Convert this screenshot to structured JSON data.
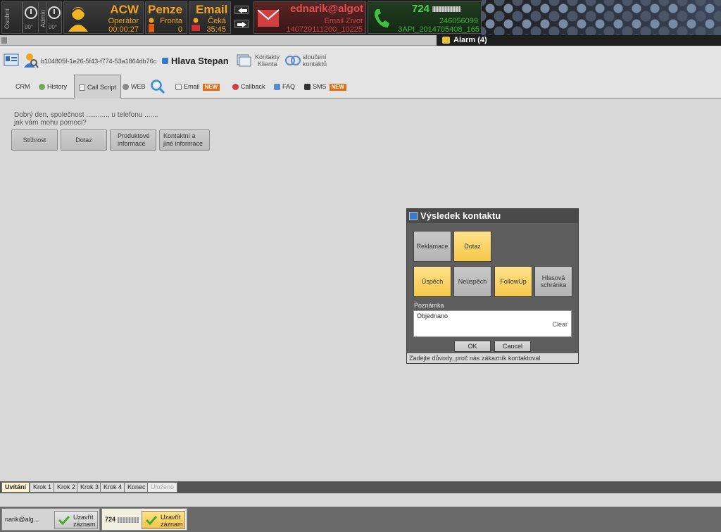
{
  "topbar": {
    "status_labels": [
      "Osobní",
      "Admin"
    ],
    "timers": [
      "00°",
      "00°"
    ],
    "acw": {
      "title": "ACW",
      "role": "Operátor",
      "time": "00:00:27"
    },
    "penze": {
      "title": "Penze",
      "label": "Fronta",
      "count": "0"
    },
    "email": {
      "title": "Email",
      "label": "Čeká",
      "time": "35:45"
    },
    "email_session": {
      "address": "ednarik@algot",
      "subject": "Email Zivot",
      "id": "140729111200_10225"
    },
    "phone_session": {
      "number": "724",
      "number2": "246056099",
      "id": "3API_2014705408_165"
    },
    "alarm": "Alarm (4)"
  },
  "header": {
    "contact_id": "b104805f-1e26-5f43-f774-53a1864db76c",
    "name": "Hlava Stepan",
    "link_contacts": [
      "Kontakty",
      "Klienta"
    ],
    "link_merge": [
      "sloučení",
      "kontaktů"
    ]
  },
  "tabs": {
    "crm": "CRM",
    "history": "History",
    "callscript": "Call Script",
    "web": "WEB",
    "email": "Email",
    "callback": "Callback",
    "faq": "FAQ",
    "sms": "SMS",
    "new_badge": "NEW"
  },
  "script": {
    "greeting_line1": "Dobrý den, společnost ..........., u telefonu .......",
    "greeting_line2": "jak vám mohu pomoci?",
    "buttons": [
      "Stížnost",
      "Dotaz",
      "Produktové informace",
      "Kontaktní a jiné informace"
    ]
  },
  "dialog": {
    "title": "Výsledek kontaktu",
    "row1": [
      "Reklamace",
      "Dotaz"
    ],
    "row2": [
      "Úspěch",
      "Neúspěch",
      "FollowUp",
      "Hlasová schránka"
    ],
    "note_label": "Poznámka",
    "note_value": "Objednano",
    "clear": "Clear",
    "ok": "OK",
    "cancel": "Cancel",
    "status": "Zadejte důvody, proč nás zákazník kontaktoval"
  },
  "steps": [
    "Uvítání",
    "Krok 1",
    "Krok 2",
    "Krok 3",
    "Krok 4",
    "Konec",
    "Uloženo"
  ],
  "taskbar": {
    "task1_label": "narik@alg...",
    "task2_label": "724",
    "close_label_1": "Uzavřít",
    "close_label_2": "záznam"
  },
  "colors": {
    "accent": "#f2a51e",
    "highlight": "#f6c84a",
    "email_red": "#d04040",
    "phone_green": "#40c040"
  }
}
